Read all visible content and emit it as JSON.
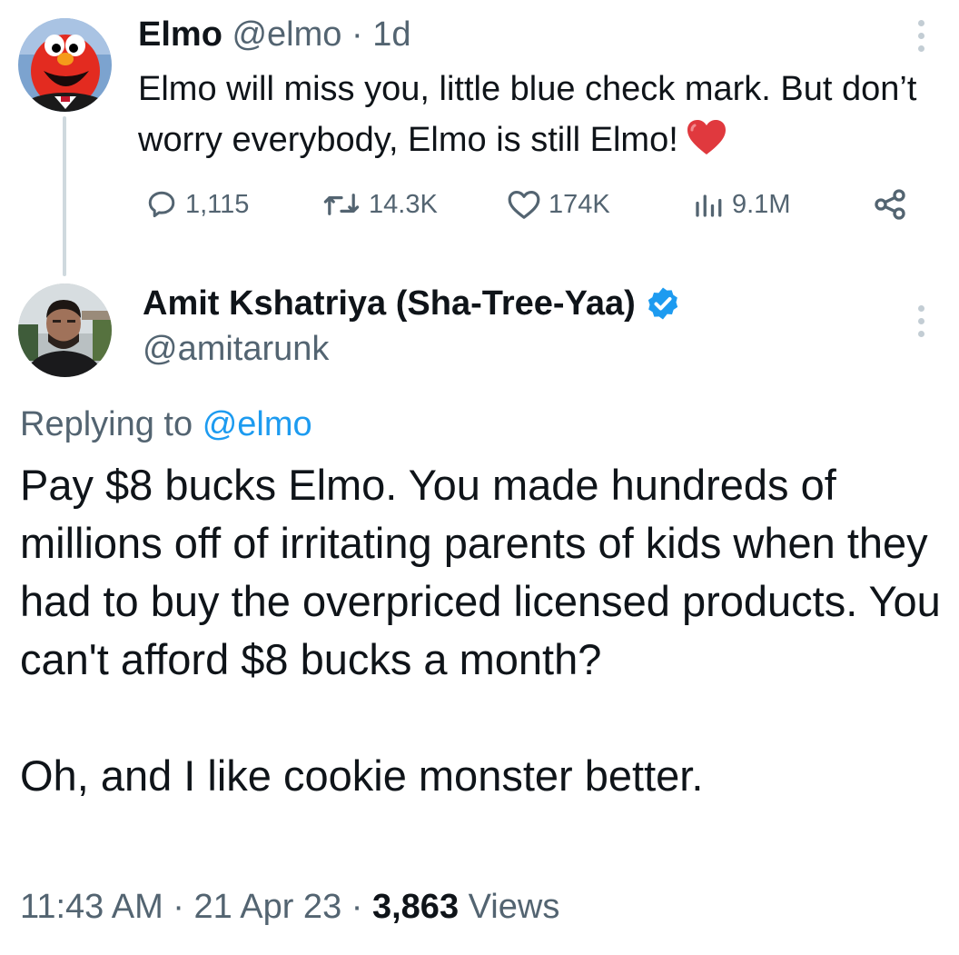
{
  "tweet1": {
    "display_name": "Elmo",
    "handle": "@elmo",
    "separator": "·",
    "age": "1d",
    "text": "Elmo will miss you, little blue check mark. But don’t worry everybody, Elmo is still Elmo!",
    "emoji_icon": "red-heart-icon",
    "avatar_icon": "elmo-avatar",
    "actions": {
      "replies": "1,115",
      "retweets": "14.3K",
      "likes": "174K",
      "views": "9.1M"
    }
  },
  "tweet2": {
    "display_name": "Amit Kshatriya (Sha-Tree-Yaa)",
    "verified_icon": "verified-badge-icon",
    "handle": "@amitarunk",
    "replying_prefix": "Replying to",
    "replying_handle": "@elmo",
    "paragraph1": "Pay $8 bucks Elmo. You made hundreds of millions off of irritating parents of kids when they had to buy the overpriced licensed products. You can't afford $8 bucks a month?",
    "paragraph2": "Oh, and I like cookie monster better.",
    "time": "11:43 AM",
    "date": "21 Apr 23",
    "separator": "·",
    "views_count": "3,863",
    "views_label": "Views"
  },
  "colors": {
    "text": "#0f1419",
    "muted": "#536471",
    "link": "#1d9bf0",
    "verified": "#1d9bf0",
    "thread_line": "#cfd9de"
  }
}
